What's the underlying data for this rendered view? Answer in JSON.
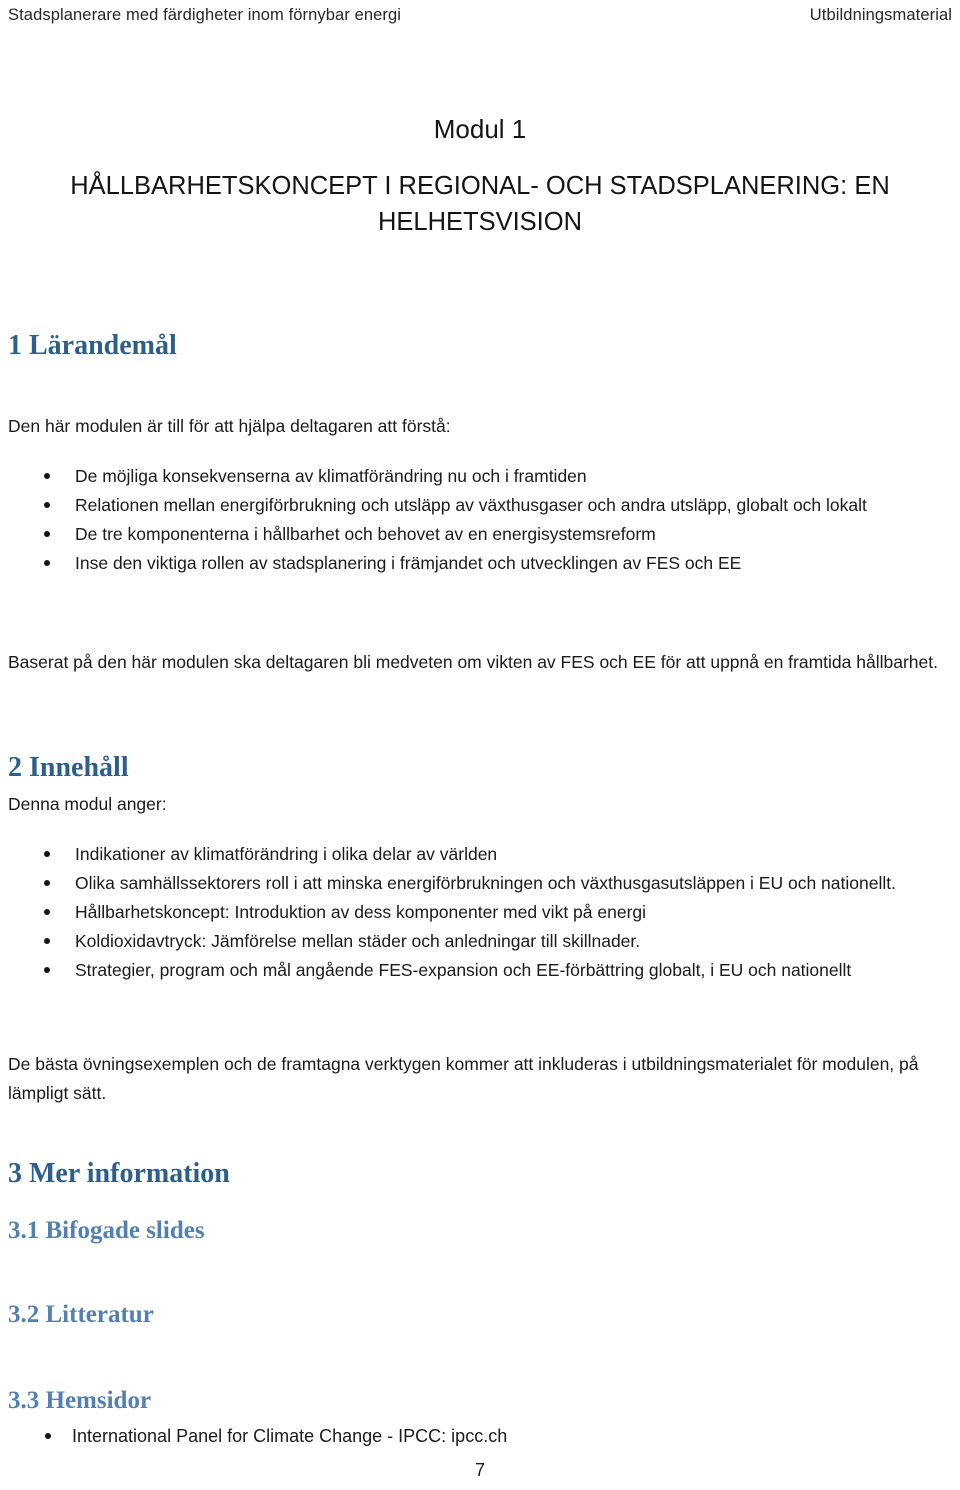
{
  "header": {
    "left": "Stadsplanerare med färdigheter inom förnybar energi",
    "right": "Utbildningsmaterial"
  },
  "title_block": {
    "module_label": "Modul 1",
    "title": "HÅLLBARHETSKONCEPT I REGIONAL- OCH STADSPLANERING: EN HELHETSVISION"
  },
  "sections": {
    "learning_goals": {
      "heading": "1 Lärandemål",
      "intro": "Den här modulen är till för att hjälpa deltagaren att förstå:",
      "bullets": [
        "De möjliga konsekvenserna av klimatförändring nu och i framtiden",
        "Relationen mellan energiförbrukning och utsläpp av växthusgaser och andra utsläpp, globalt och lokalt",
        "De tre komponenterna i hållbarhet och behovet av en energisystemsreform",
        "Inse den viktiga rollen av stadsplanering i främjandet och utvecklingen av FES och EE"
      ],
      "closing": "Baserat på den här modulen ska deltagaren bli medveten om vikten av FES och EE för att uppnå en framtida hållbarhet."
    },
    "content": {
      "heading": "2 Innehåll",
      "intro": "Denna modul anger:",
      "bullets": [
        "Indikationer av klimatförändring i olika delar av världen",
        "Olika samhällssektorers roll i att minska energiförbrukningen och växthusgasutsläppen i EU och nationellt.",
        "Hållbarhetskoncept: Introduktion av dess komponenter med vikt på energi",
        "Koldioxidavtryck: Jämförelse mellan städer och anledningar till skillnader.",
        "Strategier, program och mål angående FES-expansion och EE-förbättring globalt, i EU och nationellt"
      ],
      "closing": "De bästa övningsexemplen och de framtagna verktygen kommer att inkluderas i utbildningsmaterialet för modulen, på lämpligt sätt."
    },
    "more_information": {
      "heading": "3 Mer information",
      "subsections": {
        "slides": "3.1 Bifogade slides",
        "literature": "3.2 Litteratur",
        "websites": "3.3 Hemsidor"
      },
      "website_bullets": [
        "International Panel for Climate Change - IPCC:  ipcc.ch"
      ]
    }
  },
  "footer": {
    "page_number": "7"
  },
  "colors": {
    "heading_primary": "#2e5f8a",
    "heading_secondary": "#5480b0",
    "body_text": "#1a1a1a"
  }
}
